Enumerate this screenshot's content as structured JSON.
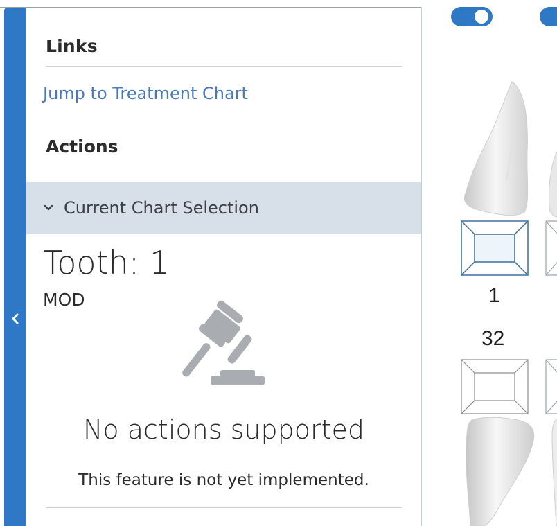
{
  "sidebar": {
    "collapse_icon": "chevron-left-icon",
    "color": "#2f78c6"
  },
  "links": {
    "heading": "Links",
    "jump_label": "Jump to Treatment Chart",
    "link_color": "#4a78b8"
  },
  "actions": {
    "heading": "Actions",
    "selection_label": "Current Chart Selection",
    "selection_bg": "#d7e0e8"
  },
  "selection": {
    "tooth_title": "Tooth: 1",
    "surfaces": "MOD",
    "empty_icon": "gavel-icon",
    "empty_title": "No actions supported",
    "empty_subtitle": "This feature is not yet implemented."
  },
  "chart": {
    "upper_tooth_number": "1",
    "lower_tooth_number": "32"
  }
}
